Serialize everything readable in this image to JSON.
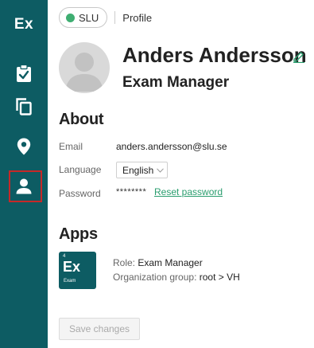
{
  "sidebar": {
    "logo": "Ex",
    "items": [
      {
        "name": "clipboard-check-icon"
      },
      {
        "name": "copy-icon"
      },
      {
        "name": "location-pin-icon"
      },
      {
        "name": "person-icon",
        "active": true
      }
    ]
  },
  "topbar": {
    "org": "SLU",
    "breadcrumb": "Profile"
  },
  "profile": {
    "name": "Anders Andersson",
    "role": "Exam Manager"
  },
  "about": {
    "heading": "About",
    "email_label": "Email",
    "email_value": "anders.andersson@slu.se",
    "language_label": "Language",
    "language_value": "English",
    "password_label": "Password",
    "password_value": "********",
    "reset_link": "Reset password"
  },
  "apps": {
    "heading": "Apps",
    "app_logo_text": "Ex",
    "app_logo_sub": "Exam",
    "app_logo_num": "4",
    "role_label": "Role:",
    "role_value": "Exam Manager",
    "group_label": "Organization group:",
    "group_value": "root > VH"
  },
  "save_button": "Save changes",
  "colors": {
    "sidebar": "#0d5c63",
    "accent": "#2a9d6e",
    "status_dot": "#3fae72",
    "active_outline": "#c62828"
  }
}
